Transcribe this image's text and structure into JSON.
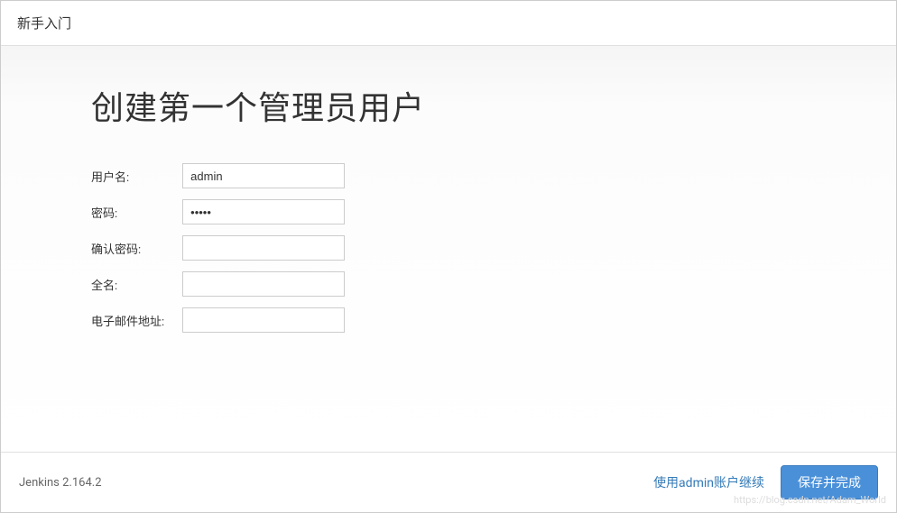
{
  "header": {
    "title": "新手入门"
  },
  "page": {
    "title": "创建第一个管理员用户"
  },
  "form": {
    "username": {
      "label": "用户名:",
      "value": "admin"
    },
    "password": {
      "label": "密码:",
      "value": "•••••"
    },
    "confirm_password": {
      "label": "确认密码:",
      "value": ""
    },
    "fullname": {
      "label": "全名:",
      "value": ""
    },
    "email": {
      "label": "电子邮件地址:",
      "value": ""
    }
  },
  "footer": {
    "version": "Jenkins 2.164.2",
    "continue_as_admin": "使用admin账户继续",
    "save_and_finish": "保存并完成"
  },
  "watermark": "https://blog.csdn.net/Adam_World"
}
